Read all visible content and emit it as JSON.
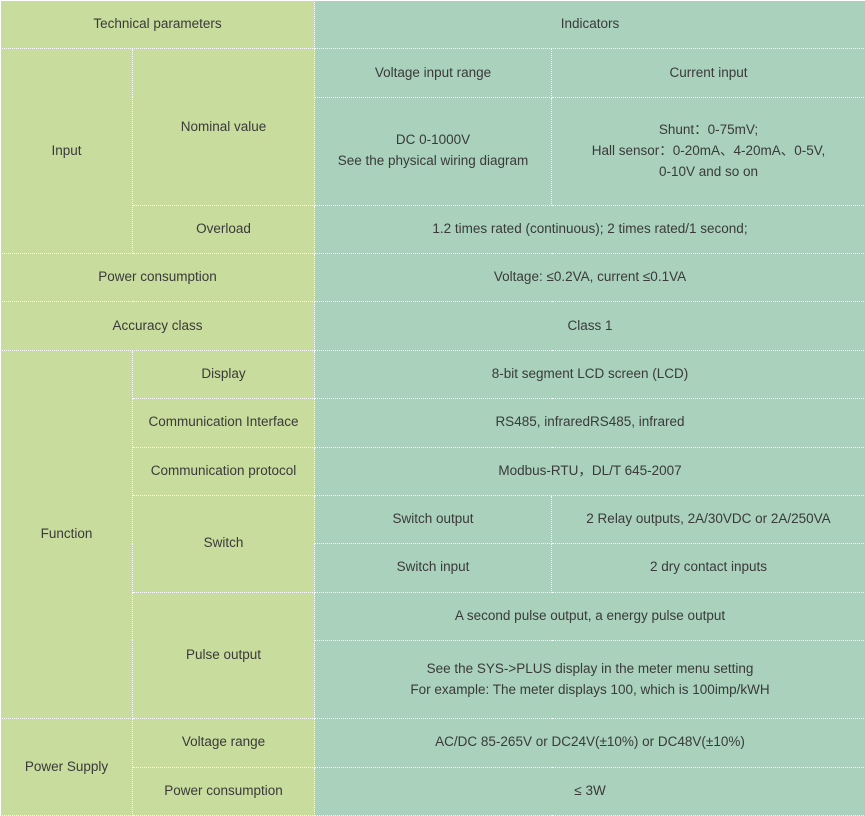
{
  "table": {
    "header": {
      "parameters": "Technical parameters",
      "indicators": "Indicators"
    },
    "sections": {
      "input": {
        "label": "Input",
        "nominal_value": {
          "label": "Nominal value",
          "voltage_input_range_header": "Voltage input range",
          "current_input_header": "Current input",
          "voltage_input_range_value": "DC 0-1000V\nSee the physical wiring diagram",
          "current_input_value": "Shunt：0-75mV;\nHall sensor：0-20mA、4-20mA、0-5V,\n0-10V and so on"
        },
        "overload": {
          "label": "Overload",
          "value": "1.2 times rated (continuous); 2 times rated/1 second;"
        },
        "power_consumption": {
          "label": "Power consumption",
          "value": "Voltage: ≤0.2VA, current ≤0.1VA"
        }
      },
      "accuracy_class": {
        "label": "Accuracy class",
        "value": "Class 1"
      },
      "function": {
        "label": "Function",
        "display": {
          "label": "Display",
          "value": "8-bit segment LCD screen (LCD)"
        },
        "communication_interface": {
          "label": "Communication Interface",
          "value": "RS485, infraredRS485, infrared"
        },
        "communication_protocol": {
          "label": "Communication protocol",
          "value": "Modbus-RTU，DL/T 645-2007"
        },
        "switch": {
          "label": "Switch",
          "output_label": "Switch output",
          "output_value": "2 Relay outputs, 2A/30VDC or 2A/250VA",
          "input_label": "Switch input",
          "input_value": "2 dry contact inputs"
        },
        "pulse_output": {
          "label": "Pulse output",
          "value_line1": "A second pulse output, a energy pulse output",
          "value_line2": "See the SYS->PLUS display in the meter menu setting\nFor example: The meter displays 100, which is 100imp/kWH"
        }
      },
      "power_supply": {
        "label": "Power Supply",
        "voltage_range": {
          "label": "Voltage range",
          "value": "AC/DC 85-265V or DC24V(±10%) or DC48V(±10%)"
        },
        "power_consumption": {
          "label": "Power consumption",
          "value": "≤ 3W"
        }
      }
    }
  },
  "colors": {
    "param_background": "#c8dc9d",
    "value_background": "#a9d1bb",
    "border": "#ffffff",
    "text": "#3a3a3a"
  }
}
